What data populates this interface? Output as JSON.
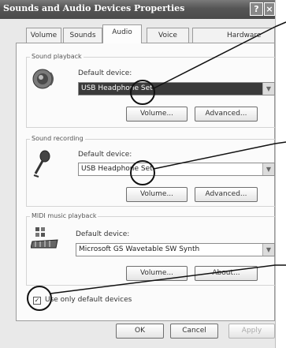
{
  "window": {
    "title": "Sounds and Audio Devices Properties",
    "help_label": "?",
    "close_label": "×"
  },
  "tabs": [
    {
      "label": "Volume"
    },
    {
      "label": "Sounds"
    },
    {
      "label": "Audio"
    },
    {
      "label": "Voice"
    },
    {
      "label": "Hardware"
    }
  ],
  "active_tab": "Audio",
  "playback": {
    "group_title": "Sound playback",
    "default_label": "Default device:",
    "device": "USB Headphone Set",
    "volume_label": "Volume...",
    "advanced_label": "Advanced..."
  },
  "recording": {
    "group_title": "Sound recording",
    "default_label": "Default device:",
    "device": "USB Headphone Set",
    "volume_label": "Volume...",
    "advanced_label": "Advanced..."
  },
  "midi": {
    "group_title": "MIDI music playback",
    "default_label": "Default device:",
    "device": "Microsoft GS Wavetable SW Synth",
    "volume_label": "Volume...",
    "about_label": "About..."
  },
  "use_default_only": {
    "label": "Use only default devices",
    "checked": true
  },
  "footer": {
    "ok_label": "OK",
    "cancel_label": "Cancel",
    "apply_label": "Apply"
  },
  "icons": {
    "playback": "speaker-icon",
    "recording": "microphone-icon",
    "midi": "midi-keyboard-icon",
    "dropdown": "chevron-down-icon"
  },
  "annotation_callouts": 4
}
